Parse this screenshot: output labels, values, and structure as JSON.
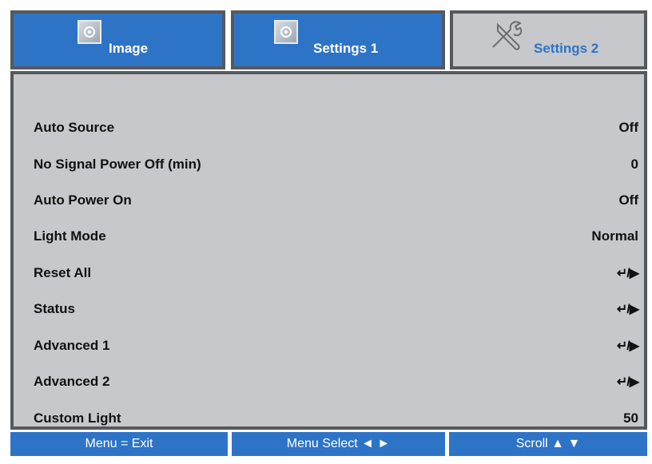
{
  "tabs": [
    {
      "label": "Image",
      "icon": "image-icon",
      "active": true
    },
    {
      "label": "Settings 1",
      "icon": "settings-icon",
      "active": true
    },
    {
      "label": "Settings 2",
      "icon": "tools-icon",
      "active": false
    }
  ],
  "menu": {
    "rows": [
      {
        "label": "Auto Source",
        "value": "Off"
      },
      {
        "label": "No Signal Power Off (min)",
        "value": "0"
      },
      {
        "label": "Auto Power On",
        "value": "Off"
      },
      {
        "label": "Light Mode",
        "value": "Normal"
      },
      {
        "label": "Reset All",
        "value": "↵/▶"
      },
      {
        "label": "Status",
        "value": "↵/▶"
      },
      {
        "label": "Advanced 1",
        "value": "↵/▶"
      },
      {
        "label": "Advanced 2",
        "value": "↵/▶"
      },
      {
        "label": "Custom Light",
        "value": "50"
      }
    ]
  },
  "hints": {
    "exit": "Menu = Exit",
    "select": "Menu Select ◄ ►",
    "scroll": "Scroll ▲ ▼"
  },
  "colors": {
    "accent": "#2e74c6",
    "panel": "#c7c8cb",
    "border": "#55595e"
  }
}
